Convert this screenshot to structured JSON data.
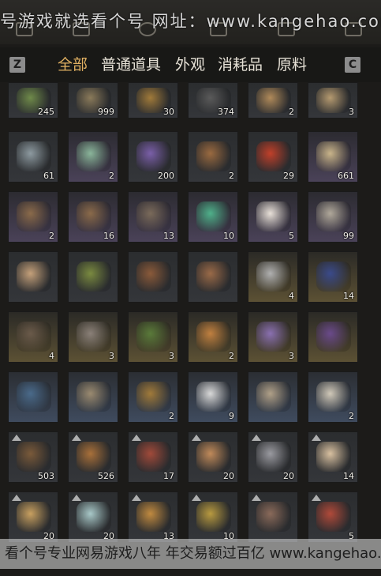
{
  "watermark_top": "号游戏就选看个号 网址：www.kangehao.com",
  "watermark_bottom": "看个号专业网易游戏八年 年交易额过百亿 www.kangehao.com",
  "keys": {
    "left": "Z",
    "right": "C"
  },
  "tabs": [
    {
      "label": "全部",
      "active": true
    },
    {
      "label": "普通道具",
      "active": false
    },
    {
      "label": "外观",
      "active": false
    },
    {
      "label": "消耗品",
      "active": false
    },
    {
      "label": "原料",
      "active": false
    }
  ],
  "rows": [
    [
      {
        "icon": "bamboo-bundle-icon",
        "count": "245",
        "rarity": "plain",
        "color": "#6f8a4a"
      },
      {
        "icon": "log-bundle-icon",
        "count": "999",
        "rarity": "plain",
        "color": "#8a7a5a"
      },
      {
        "icon": "ore-pile-icon",
        "count": "30",
        "rarity": "plain",
        "color": "#a07a3a"
      },
      {
        "icon": "stone-icon",
        "count": "374",
        "rarity": "plain",
        "color": "#5a5a5a"
      },
      {
        "icon": "hide-icon",
        "count": "2",
        "rarity": "plain",
        "color": "#b08a5a"
      },
      {
        "icon": "cloth-bundle-icon",
        "count": "3",
        "rarity": "plain",
        "color": "#b59a70"
      }
    ],
    [
      {
        "icon": "fish-icon",
        "count": "61",
        "rarity": "plain",
        "color": "#8d9aa0"
      },
      {
        "icon": "gift-box-icon",
        "count": "2",
        "rarity": "purple",
        "color": "#8ab59a"
      },
      {
        "icon": "lavender-icon",
        "count": "200",
        "rarity": "plain",
        "color": "#7a5fa8"
      },
      {
        "icon": "soup-pot-icon",
        "count": "2",
        "rarity": "plain",
        "color": "#9a6a40"
      },
      {
        "icon": "red-gem-icon",
        "count": "29",
        "rarity": "plain",
        "color": "#c0402a"
      },
      {
        "icon": "letter-icon",
        "count": "661",
        "rarity": "purple",
        "color": "#c9b48a"
      }
    ],
    [
      {
        "icon": "chest-icon",
        "count": "2",
        "rarity": "purple",
        "color": "#8a6a4a"
      },
      {
        "icon": "chest-icon",
        "count": "16",
        "rarity": "purple",
        "color": "#8a6a4a"
      },
      {
        "icon": "crate-icon",
        "count": "13",
        "rarity": "purple",
        "color": "#7a6a5a"
      },
      {
        "icon": "jade-icon",
        "count": "10",
        "rarity": "purple",
        "color": "#4fb08a"
      },
      {
        "icon": "talisman-icon",
        "count": "5",
        "rarity": "purple",
        "color": "#e8e0d8"
      },
      {
        "icon": "coin-icon",
        "count": "99",
        "rarity": "purple",
        "color": "#b0a89a"
      }
    ],
    [
      {
        "icon": "stone-ball-icon",
        "count": "",
        "rarity": "plain",
        "color": "#c4a07a"
      },
      {
        "icon": "dumplings-icon",
        "count": "",
        "rarity": "plain",
        "color": "#7a8a40"
      },
      {
        "icon": "bowl-icon",
        "count": "",
        "rarity": "plain",
        "color": "#8a5a3a"
      },
      {
        "icon": "bowl-icon",
        "count": "",
        "rarity": "plain",
        "color": "#9a6a48"
      },
      {
        "icon": "dragon-stone-icon",
        "count": "4",
        "rarity": "gold",
        "color": "#b0b0b0"
      },
      {
        "icon": "blue-flower-icon",
        "count": "14",
        "rarity": "gold",
        "color": "#3a4a8a"
      }
    ],
    [
      {
        "icon": "rat-icon",
        "count": "4",
        "rarity": "gold",
        "color": "#6a5a4a"
      },
      {
        "icon": "egg-icon",
        "count": "3",
        "rarity": "gold",
        "color": "#8a8078"
      },
      {
        "icon": "mantis-icon",
        "count": "3",
        "rarity": "gold",
        "color": "#5a7a3a"
      },
      {
        "icon": "firefly-icon",
        "count": "2",
        "rarity": "gold",
        "color": "#c08040"
      },
      {
        "icon": "dragonfly-icon",
        "count": "3",
        "rarity": "gold",
        "color": "#8a70b0"
      },
      {
        "icon": "purple-herb-icon",
        "count": "",
        "rarity": "gold",
        "color": "#6a4a8a"
      }
    ],
    [
      {
        "icon": "scroll-icon",
        "count": "",
        "rarity": "blue",
        "color": "#4a6a8a"
      },
      {
        "icon": "rolled-scroll-icon",
        "count": "",
        "rarity": "blue",
        "color": "#9a8a70"
      },
      {
        "icon": "noodle-bowl-icon",
        "count": "2",
        "rarity": "blue",
        "color": "#a07a3a"
      },
      {
        "icon": "mountain-emblem-icon",
        "count": "9",
        "rarity": "blue",
        "color": "#d8d8d8"
      },
      {
        "icon": "book-icon",
        "count": "",
        "rarity": "blue",
        "color": "#b0a088"
      },
      {
        "icon": "mountain-diorama-icon",
        "count": "2",
        "rarity": "blue",
        "color": "#d0c8b8"
      }
    ],
    [
      {
        "icon": "stew-icon",
        "count": "503",
        "rarity": "plain",
        "badge": true,
        "color": "#7a5a3a"
      },
      {
        "icon": "bun-plate-icon",
        "count": "526",
        "rarity": "plain",
        "badge": true,
        "color": "#a8703a"
      },
      {
        "icon": "meat-plate-icon",
        "count": "17",
        "rarity": "plain",
        "badge": true,
        "color": "#a04a3a"
      },
      {
        "icon": "pancake-plate-icon",
        "count": "20",
        "rarity": "plain",
        "badge": true,
        "color": "#c08a5a"
      },
      {
        "icon": "fish-plate-icon",
        "count": "20",
        "rarity": "plain",
        "badge": true,
        "color": "#9a9aa0"
      },
      {
        "icon": "bun-icon",
        "count": "14",
        "rarity": "plain",
        "badge": true,
        "color": "#d8c0a0"
      }
    ],
    [
      {
        "icon": "noodle-bowl-icon",
        "count": "20",
        "rarity": "plain",
        "badge": true,
        "color": "#c8a060"
      },
      {
        "icon": "vase-icon",
        "count": "20",
        "rarity": "plain",
        "badge": true,
        "color": "#a8c8c8"
      },
      {
        "icon": "dish-icon",
        "count": "13",
        "rarity": "plain",
        "badge": true,
        "color": "#c08a40"
      },
      {
        "icon": "fried-rice-icon",
        "count": "10",
        "rarity": "plain",
        "badge": true,
        "color": "#b89a40"
      },
      {
        "icon": "seafood-bowl-icon",
        "count": "",
        "rarity": "plain",
        "badge": true,
        "color": "#8a6a5a"
      },
      {
        "icon": "red-dish-icon",
        "count": "5",
        "rarity": "plain",
        "badge": true,
        "color": "#b04a3a"
      }
    ]
  ]
}
